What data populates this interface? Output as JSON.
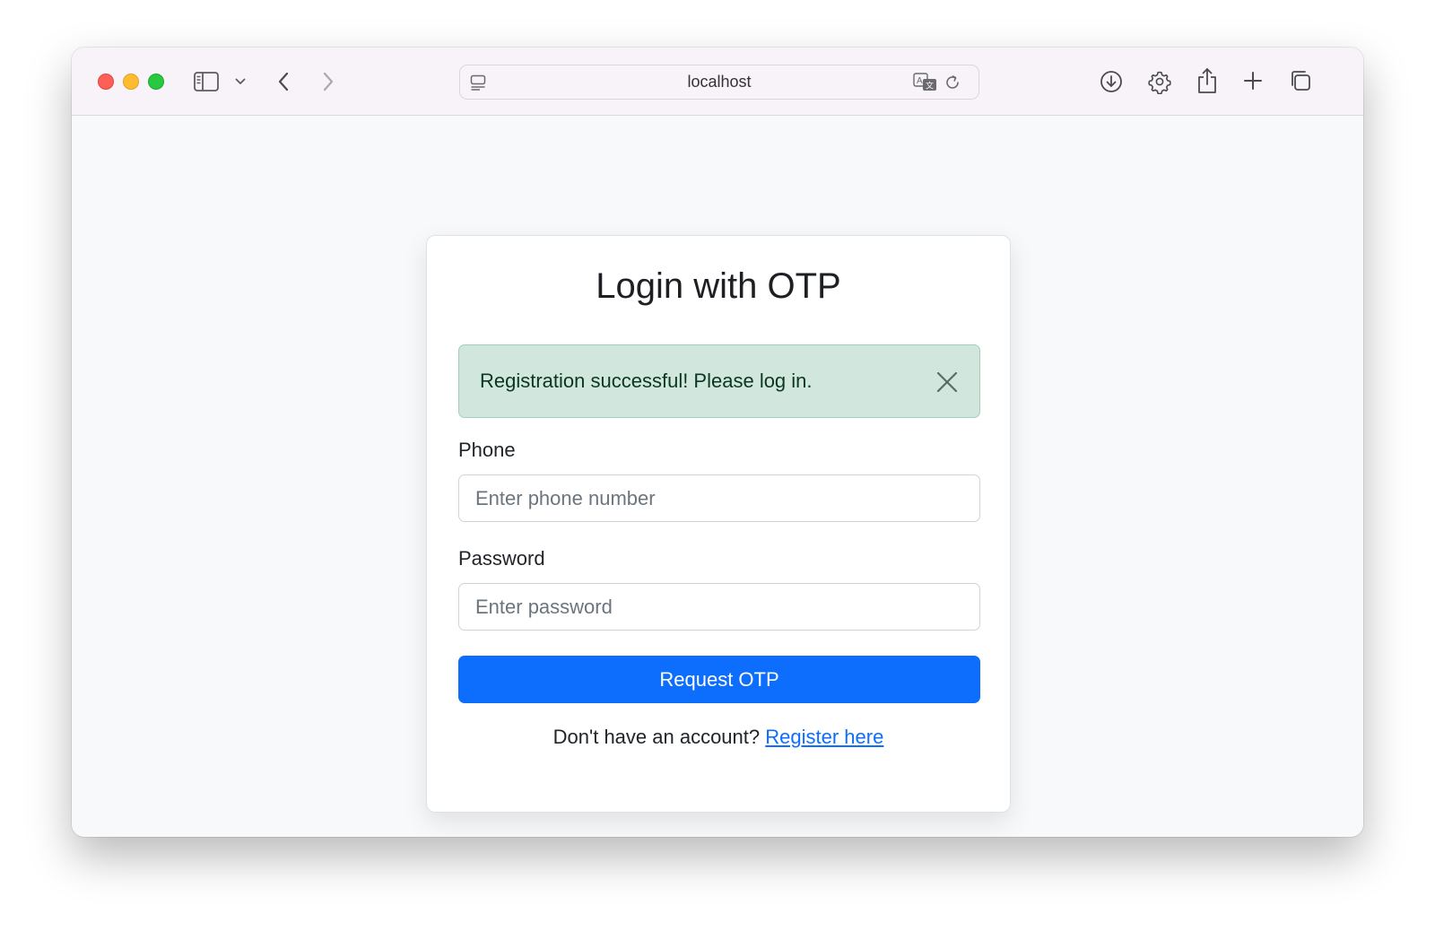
{
  "browser": {
    "address": "localhost",
    "icons": {
      "sidebar": "sidebar-icon",
      "chevron": "chevron-down-icon",
      "back": "back-icon",
      "forward": "forward-icon",
      "site_settings": "page-menu-icon",
      "translate": "translate-icon",
      "reload": "reload-icon",
      "downloads": "download-icon",
      "settings": "gear-icon",
      "share": "share-icon",
      "new_tab": "plus-icon",
      "tabs": "tabs-overview-icon"
    }
  },
  "page": {
    "title": "Login with OTP",
    "alert": {
      "message": "Registration successful! Please log in.",
      "close_icon": "close-icon"
    },
    "form": {
      "phone_label": "Phone",
      "phone_placeholder": "Enter phone number",
      "phone_value": "",
      "password_label": "Password",
      "password_placeholder": "Enter password",
      "password_value": "",
      "submit_label": "Request OTP"
    },
    "footer": {
      "prompt": "Don't have an account?",
      "link_text": "Register here"
    }
  },
  "colors": {
    "primary": "#0d6efd",
    "alert_bg": "#d1e7dd",
    "alert_border": "#a3cfbb",
    "alert_text": "#0a3622",
    "traffic_red": "#fe5f57",
    "traffic_yellow": "#febc2e",
    "traffic_green": "#28c840"
  }
}
